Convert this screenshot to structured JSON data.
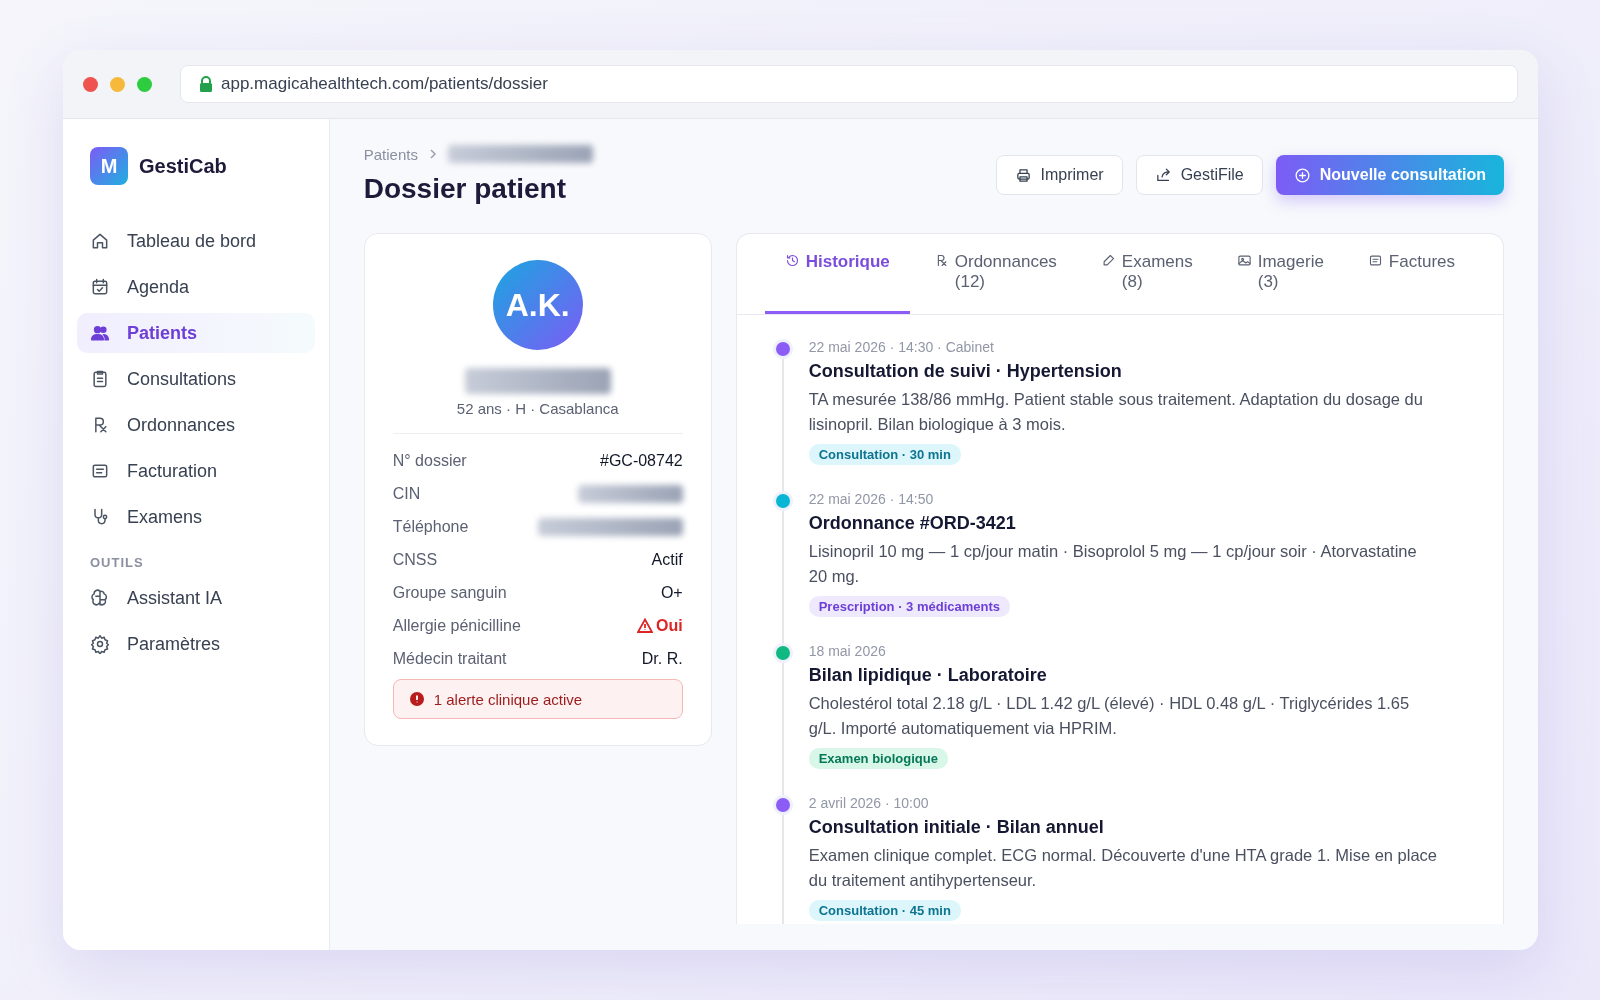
{
  "browser": {
    "url": "app.magicahealthtech.com/patients/dossier"
  },
  "sidebar": {
    "logo_letter": "M",
    "app_name": "GestiCab",
    "items": [
      {
        "label": "Tableau de bord",
        "selected": false
      },
      {
        "label": "Agenda",
        "selected": false
      },
      {
        "label": "Patients",
        "selected": true
      },
      {
        "label": "Consultations",
        "selected": false
      },
      {
        "label": "Ordonnances",
        "selected": false
      },
      {
        "label": "Facturation",
        "selected": false
      },
      {
        "label": "Examens",
        "selected": false
      }
    ],
    "section_title": "OUTILS",
    "tools": [
      {
        "label": "Assistant IA",
        "selected": false
      },
      {
        "label": "Paramètres",
        "selected": false
      }
    ]
  },
  "header": {
    "breadcrumb": "Patients",
    "title": "Dossier patient",
    "buttons": [
      {
        "label": "Imprimer",
        "kind": "secondary"
      },
      {
        "label": "GestiFile",
        "kind": "secondary"
      },
      {
        "label": "Nouvelle consultation",
        "kind": "primary"
      }
    ]
  },
  "patient": {
    "initials": "A.K.",
    "summary": "52 ans · H · Casablanca",
    "fields": [
      {
        "label": "N° dossier",
        "value": "#GC-08742",
        "alert": false
      },
      {
        "label": "CIN"
      },
      {
        "label": "Téléphone"
      },
      {
        "label": "CNSS",
        "value": "Actif",
        "alert": false
      },
      {
        "label": "Groupe sanguin",
        "value": "O+",
        "alert": false
      },
      {
        "label": "Allergie pénicilline",
        "value": "Oui",
        "alert": true
      },
      {
        "label": "Médecin traitant",
        "value": "Dr. R.",
        "alert": false
      }
    ],
    "alert_banner": "1 alerte clinique active"
  },
  "tabs": [
    {
      "label": "Historique",
      "selected": true
    },
    {
      "label": "Ordonnances",
      "count": "(12)",
      "selected": false
    },
    {
      "label": "Examens",
      "count": "(8)",
      "selected": false
    },
    {
      "label": "Imagerie",
      "count": "(3)",
      "selected": false
    },
    {
      "label": "Factures",
      "selected": false
    }
  ],
  "timeline": [
    {
      "meta": "22 mai 2026 · 14:30 · Cabinet",
      "title": "Consultation de suivi · Hypertension",
      "text": "TA mesurée 138/86 mmHg. Patient stable sous traitement. Adaptation du dosage du lisinopril. Bilan biologique à 3 mois.",
      "tag": "Consultation · 30 min",
      "kind": "consultation",
      "color": "#8b5cf6"
    },
    {
      "meta": "22 mai 2026 · 14:50",
      "title": "Ordonnance #ORD-3421",
      "text": "Lisinopril 10 mg — 1 cp/jour matin · Bisoprolol 5 mg — 1 cp/jour soir · Atorvastatine 20 mg.",
      "tag": "Prescription · 3 médicaments",
      "kind": "prescription",
      "color": "#06b6d4"
    },
    {
      "meta": "18 mai 2026",
      "title": "Bilan lipidique · Laboratoire",
      "text": "Cholestérol total 2.18 g/L · LDL 1.42 g/L (élevé) · HDL 0.48 g/L · Triglycérides 1.65 g/L. Importé automatiquement via HPRIM.",
      "tag": "Examen biologique",
      "kind": "exam",
      "color": "#10b981"
    },
    {
      "meta": "2 avril 2026 · 10:00",
      "title": "Consultation initiale · Bilan annuel",
      "text": "Examen clinique complet. ECG normal. Découverte d'une HTA grade 1. Mise en place du traitement antihypertenseur.",
      "tag": "Consultation · 45 min",
      "kind": "consultation",
      "color": "#8b5cf6"
    }
  ]
}
